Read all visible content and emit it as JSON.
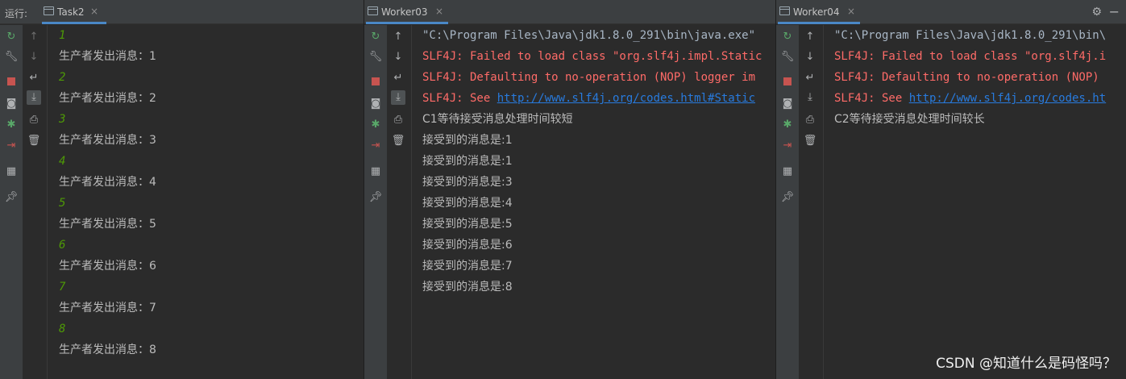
{
  "run_label": "运行:",
  "panes": [
    {
      "tab": "Task2",
      "lines": [
        {
          "text": "1"
        },
        {
          "text": "生产者发出消息：1"
        },
        {
          "text": "2"
        },
        {
          "text": "生产者发出消息：2"
        },
        {
          "text": "3"
        },
        {
          "text": "生产者发出消息：3"
        },
        {
          "text": "4"
        },
        {
          "text": "生产者发出消息：4"
        },
        {
          "text": "5"
        },
        {
          "text": "生产者发出消息：5"
        },
        {
          "text": "6"
        },
        {
          "text": "生产者发出消息：6"
        },
        {
          "text": "7"
        },
        {
          "text": "生产者发出消息：7"
        },
        {
          "text": "8"
        },
        {
          "text": "生产者发出消息：8"
        }
      ]
    },
    {
      "tab": "Worker03",
      "lines": [
        {
          "text": "\"C:\\Program Files\\Java\\jdk1.8.0_291\\bin\\java.exe\""
        },
        {
          "text": "SLF4J: Failed to load class \"org.slf4j.impl.Static"
        },
        {
          "text": "SLF4J: Defaulting to no-operation (NOP) logger im"
        },
        {
          "text_prefix": "SLF4J: See ",
          "link": "http://www.slf4j.org/codes.html#Static"
        },
        {
          "text": "C1等待接受消息处理时间较短"
        },
        {
          "text": "接受到的消息是:1"
        },
        {
          "text": "接受到的消息是:1"
        },
        {
          "text": "接受到的消息是:3"
        },
        {
          "text": "接受到的消息是:4"
        },
        {
          "text": "接受到的消息是:5"
        },
        {
          "text": "接受到的消息是:6"
        },
        {
          "text": "接受到的消息是:7"
        },
        {
          "text": "接受到的消息是:8"
        }
      ]
    },
    {
      "tab": "Worker04",
      "lines": [
        {
          "text": "\"C:\\Program Files\\Java\\jdk1.8.0_291\\bin\\"
        },
        {
          "text": "SLF4J: Failed to load class \"org.slf4j.i"
        },
        {
          "text": "SLF4J: Defaulting to no-operation (NOP)"
        },
        {
          "text_prefix": "SLF4J: See ",
          "link": "http://www.slf4j.org/codes.ht"
        },
        {
          "text": "C2等待接受消息处理时间较长"
        }
      ]
    }
  ],
  "close_glyph": "×",
  "watermark": "CSDN @知道什么是码怪吗？",
  "colors": {
    "background": "#2b2b2b",
    "toolbar": "#3c3f41",
    "tab_underline": "#4a88c7",
    "console_green": "#4e9a06",
    "console_text": "#bbbbbb",
    "error_red": "#ff6b68",
    "link_blue": "#287bde"
  },
  "icons": {
    "left_col": [
      "rerun-icon",
      "wrench-icon",
      "stop-icon",
      "camera-icon",
      "debug-bug-icon",
      "exit-icon",
      "layout-icon",
      "pin-icon"
    ],
    "right_col": [
      "arrow-up-icon",
      "arrow-down-icon",
      "soft-wrap-icon",
      "scroll-to-end-icon",
      "print-icon",
      "trash-icon"
    ]
  }
}
